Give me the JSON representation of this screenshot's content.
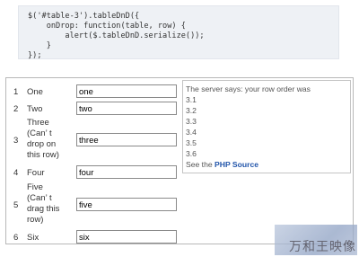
{
  "code": {
    "lines": [
      "$('#table-3').tableDnD({",
      "    onDrop: function(table, row) {",
      "        alert($.tableDnD.serialize());",
      "    }",
      "});"
    ]
  },
  "table": {
    "rows": [
      {
        "num": "1",
        "label": "One",
        "value": "one"
      },
      {
        "num": "2",
        "label": "Two",
        "value": "two"
      },
      {
        "num": "3",
        "label_lines": [
          "Three",
          "(Can’ t",
          "drop on",
          "this row)"
        ],
        "value": "three"
      },
      {
        "num": "4",
        "label": "Four",
        "value": "four"
      },
      {
        "num": "5",
        "label_lines": [
          "Five",
          "(Can’ t",
          "drag this",
          "row)"
        ],
        "value": "five"
      },
      {
        "num": "6",
        "label": "Six",
        "value": "six"
      }
    ]
  },
  "result": {
    "intro": "The server says: your row order was",
    "items": [
      "3.1",
      "3.2",
      "3.3",
      "3.4",
      "3.5",
      "3.6"
    ],
    "see_prefix": "See the ",
    "link_label": "PHP Source"
  },
  "watermark": {
    "text": "万和王映像"
  }
}
